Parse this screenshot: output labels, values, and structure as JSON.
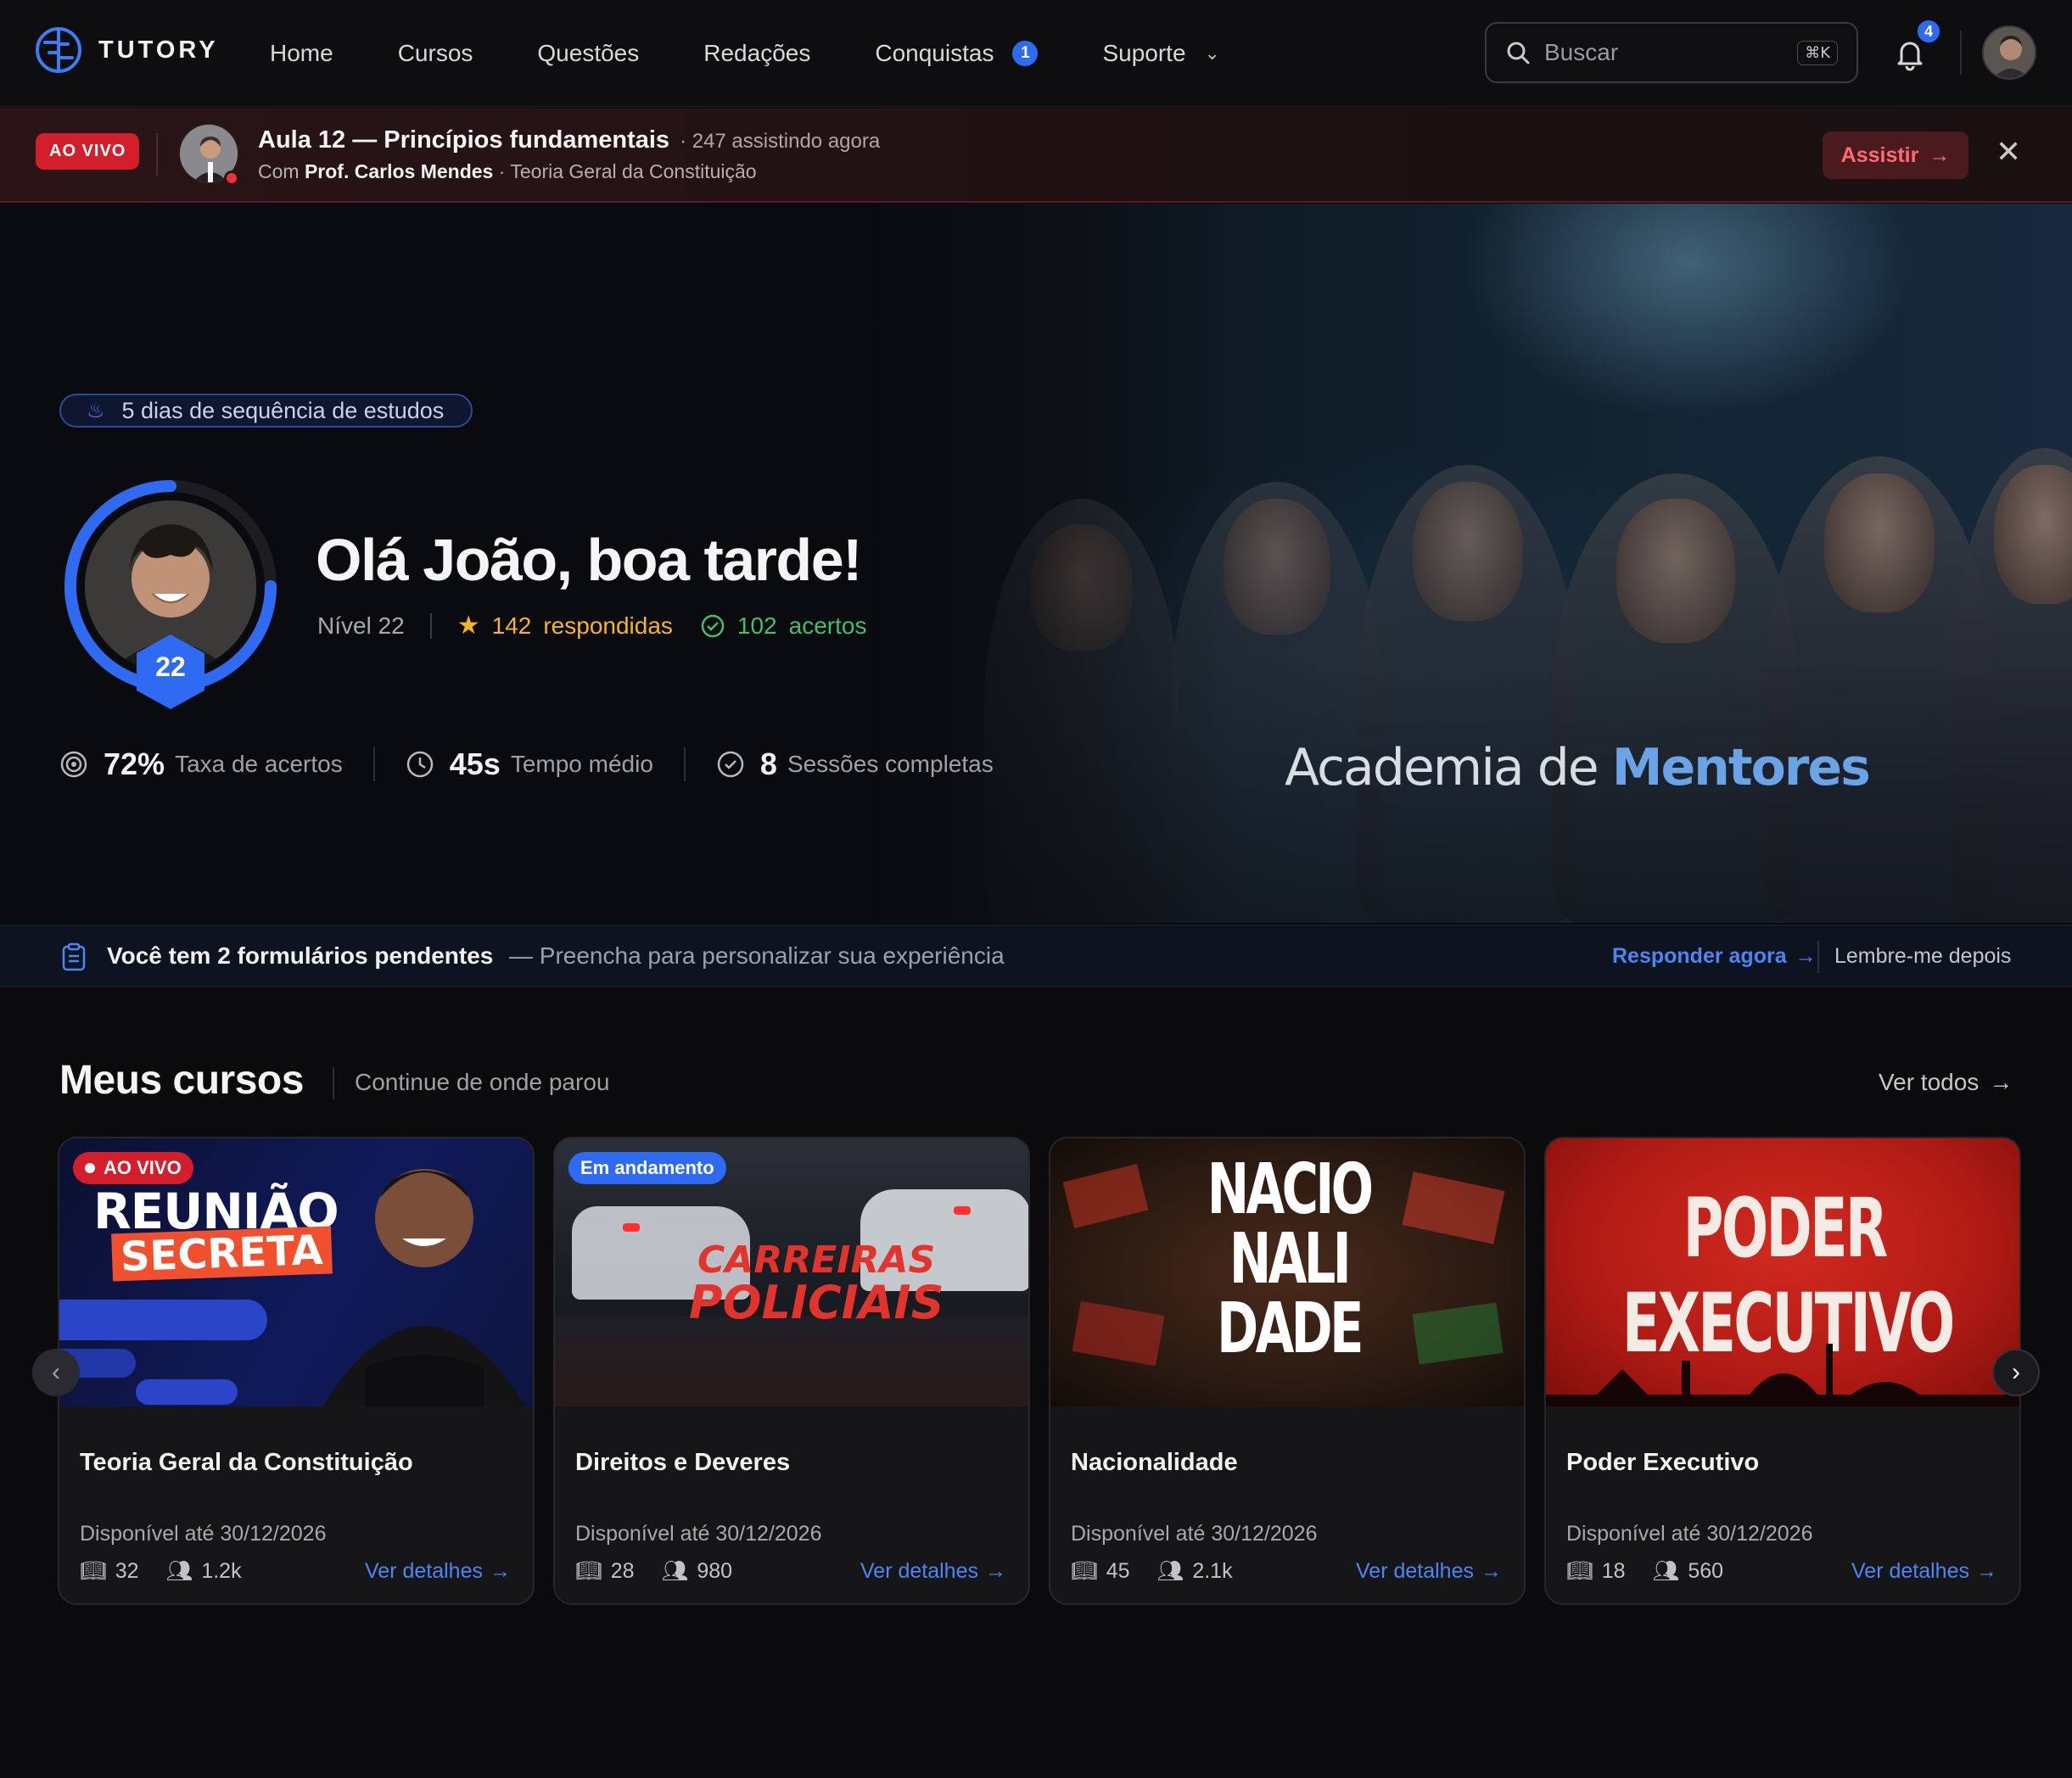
{
  "brand": {
    "name": "TUTORY"
  },
  "nav": {
    "items": [
      {
        "label": "Home"
      },
      {
        "label": "Cursos"
      },
      {
        "label": "Questões"
      },
      {
        "label": "Redações"
      },
      {
        "label": "Conquistas",
        "badge": "1"
      },
      {
        "label": "Suporte"
      }
    ]
  },
  "search": {
    "placeholder": "Buscar",
    "shortcut": "⌘K"
  },
  "notifications": {
    "count": "4"
  },
  "live": {
    "pill": "AO VIVO",
    "title": "Aula 12 — Princípios fundamentais",
    "watching": "· 247 assistindo agora",
    "with": "Com",
    "teacher": "Prof. Carlos Mendes",
    "course": "· Teoria Geral da Constituição",
    "cta": "Assistir"
  },
  "hero": {
    "streak": "5 dias de sequência de estudos",
    "greeting": "Olá João, boa tarde!",
    "level_label": "Nível 22",
    "level_num": "22",
    "answered_num": "142",
    "answered_lbl": "respondidas",
    "correct_num": "102",
    "correct_lbl": "acertos",
    "stats": [
      {
        "value": "72%",
        "label": "Taxa de acertos"
      },
      {
        "value": "45s",
        "label": "Tempo médio"
      },
      {
        "value": "8",
        "label": "Sessões completas"
      }
    ],
    "banner_logo_a": "Academia de",
    "banner_logo_b": "Mentores"
  },
  "pending": {
    "title": "Você tem 2 formulários pendentes",
    "sub": "— Preencha para personalizar sua experiência",
    "cta": "Responder agora",
    "later": "Lembre-me depois"
  },
  "courses": {
    "title": "Meus cursos",
    "sub": "Continue de onde parou",
    "see_all": "Ver todos",
    "items": [
      {
        "title": "Teoria Geral da Constituição",
        "available": "Disponível até 30/12/2026",
        "lessons": "32",
        "students": "1.2k",
        "link": "Ver detalhes",
        "tag": "AO VIVO",
        "thumb_a": "REUNIÃO",
        "thumb_b": "SECRETA"
      },
      {
        "title": "Direitos e Deveres",
        "available": "Disponível até 30/12/2026",
        "lessons": "28",
        "students": "980",
        "link": "Ver detalhes",
        "tag": "Em andamento",
        "thumb_a": "CARREIRAS",
        "thumb_b": "POLICIAIS"
      },
      {
        "title": "Nacionalidade",
        "available": "Disponível até 30/12/2026",
        "lessons": "45",
        "students": "2.1k",
        "link": "Ver detalhes",
        "thumb_a": "NACIO",
        "thumb_b": "NALI",
        "thumb_c": "DADE"
      },
      {
        "title": "Poder Executivo",
        "available": "Disponível até 30/12/2026",
        "lessons": "18",
        "students": "560",
        "link": "Ver detalhes",
        "thumb_a": "PODER",
        "thumb_b": "EXECUTIVO"
      }
    ]
  }
}
